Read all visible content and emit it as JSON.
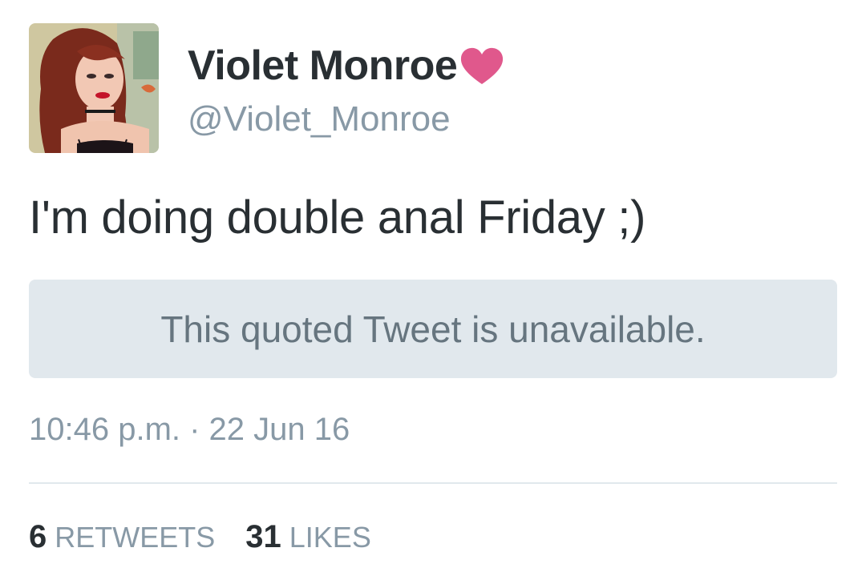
{
  "author": {
    "display_name": "Violet Monroe",
    "handle": "@Violet_Monroe",
    "badge_icon": "heart-icon",
    "badge_color": "#e0588c"
  },
  "tweet": {
    "text": "I'm doing double anal Friday ;)",
    "quoted": {
      "text": "This quoted Tweet is unavailable."
    },
    "timestamp": "10:46 p.m. · 22 Jun 16"
  },
  "stats": {
    "retweets_count": "6",
    "retweets_label": "RETWEETS",
    "likes_count": "31",
    "likes_label": "LIKES"
  },
  "colors": {
    "text_primary": "#292f33",
    "text_secondary": "#8899a6",
    "quote_background": "#e1e8ed"
  }
}
